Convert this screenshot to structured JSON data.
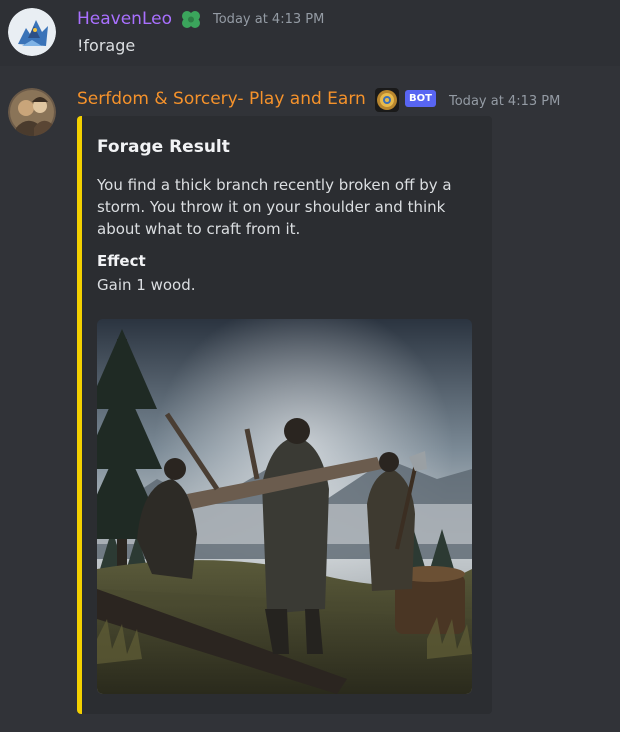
{
  "messages": [
    {
      "username": "HeavenLeo",
      "username_color": "#a970ff",
      "role_icon": "green-clover-icon",
      "timestamp": "Today at 4:13 PM",
      "content": "!forage"
    },
    {
      "username": "Serfdom & Sorcery- Play and Earn",
      "username_color": "#f5922b",
      "role_icon": "gold-coin-icon",
      "bot_tag": "BOT",
      "timestamp": "Today at 4:13 PM",
      "embed": {
        "accent_color": "#f3d000",
        "title": "Forage Result",
        "description": "You find a thick branch recently broken off by a storm. You throw it on your shoulder and think about what to craft from it.",
        "field_name": "Effect",
        "field_value": "Gain 1 wood.",
        "image": "peasants-foraging-wood-forest"
      }
    }
  ]
}
